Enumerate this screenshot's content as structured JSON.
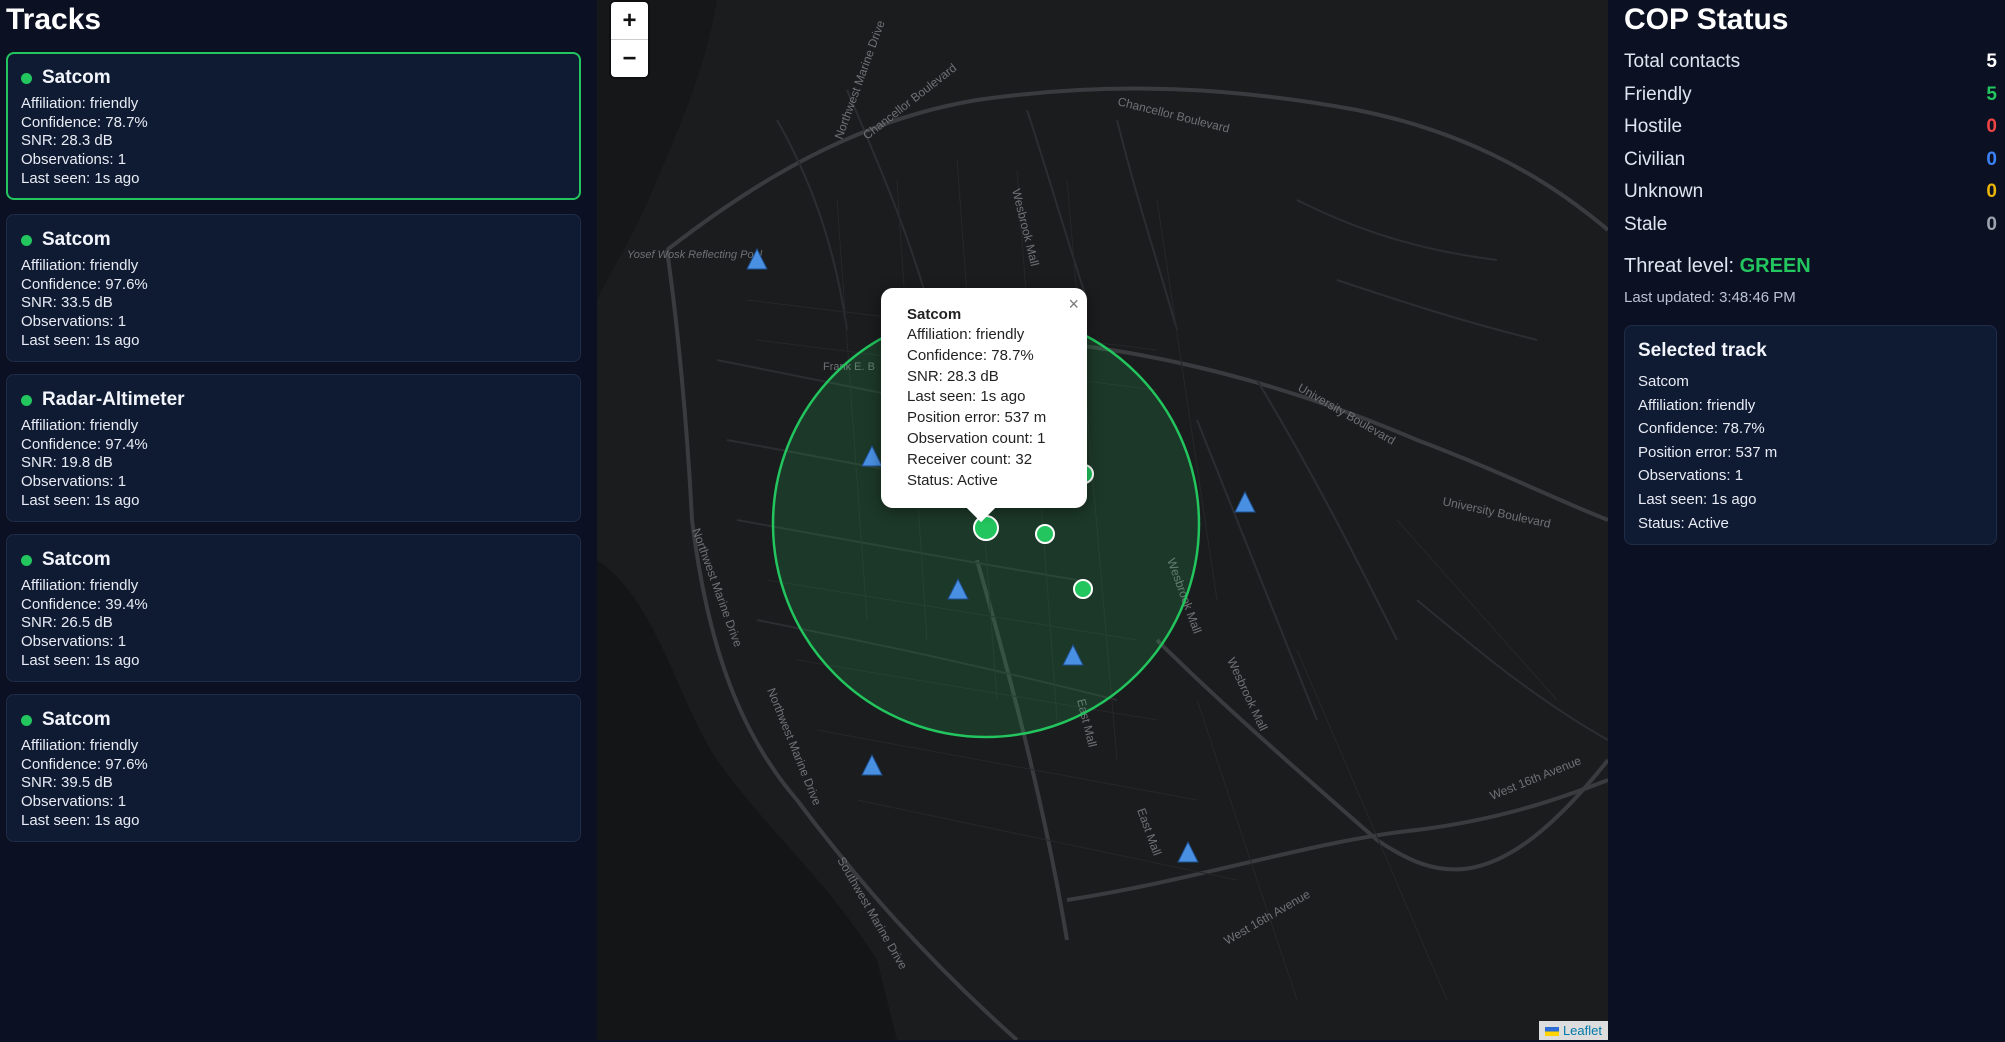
{
  "left_panel": {
    "title": "Tracks",
    "tracks": [
      {
        "name": "Satcom",
        "affiliation": "Affiliation: friendly",
        "confidence": "Confidence: 78.7%",
        "snr": "SNR: 28.3 dB",
        "observations": "Observations: 1",
        "last_seen": "Last seen: 1s ago",
        "status_color": "#22c55e"
      },
      {
        "name": "Satcom",
        "affiliation": "Affiliation: friendly",
        "confidence": "Confidence: 97.6%",
        "snr": "SNR: 33.5 dB",
        "observations": "Observations: 1",
        "last_seen": "Last seen: 1s ago",
        "status_color": "#22c55e"
      },
      {
        "name": "Radar-Altimeter",
        "affiliation": "Affiliation: friendly",
        "confidence": "Confidence: 97.4%",
        "snr": "SNR: 19.8 dB",
        "observations": "Observations: 1",
        "last_seen": "Last seen: 1s ago",
        "status_color": "#22c55e"
      },
      {
        "name": "Satcom",
        "affiliation": "Affiliation: friendly",
        "confidence": "Confidence: 39.4%",
        "snr": "SNR: 26.5 dB",
        "observations": "Observations: 1",
        "last_seen": "Last seen: 1s ago",
        "status_color": "#22c55e"
      },
      {
        "name": "Satcom",
        "affiliation": "Affiliation: friendly",
        "confidence": "Confidence: 97.6%",
        "snr": "SNR: 39.5 dB",
        "observations": "Observations: 1",
        "last_seen": "Last seen: 1s ago",
        "status_color": "#22c55e"
      }
    ]
  },
  "map": {
    "zoom_in_label": "+",
    "zoom_out_label": "−",
    "attribution": "Leaflet",
    "street_labels": [
      "Chancellor Boulevard",
      "Chancellor Boulevard",
      "University Boulevard",
      "University Boulevard",
      "Northwest Marine Drive",
      "Northwest Marine Drive",
      "Northwest Marine Drive",
      "Southwest Marine Drive",
      "Wesbrook Mall",
      "Wesbrook Mall",
      "Wesbrook Mall",
      "East Mall",
      "East Mall",
      "West 16th Avenue",
      "West 16th Avenue",
      "Yosef Wosk Reflecting Pool",
      "Frank E. B"
    ],
    "popup": {
      "title": "Satcom",
      "lines": [
        "Affiliation: friendly",
        "Confidence: 78.7%",
        "SNR: 28.3 dB",
        "Last seen: 1s ago",
        "Position error: 537 m",
        "Observation count: 1",
        "Receiver count: 32",
        "Status: Active"
      ],
      "close_glyph": "×"
    },
    "colors": {
      "friendly": "#22c55e",
      "receiver": "#4a90e2",
      "background": "#1a1b1d"
    }
  },
  "right_panel": {
    "title": "COP Status",
    "stats": [
      {
        "label": "Total contacts",
        "value": "5",
        "color": "#ffffff"
      },
      {
        "label": "Friendly",
        "value": "5",
        "color": "#22c55e"
      },
      {
        "label": "Hostile",
        "value": "0",
        "color": "#ef4444"
      },
      {
        "label": "Civilian",
        "value": "0",
        "color": "#3b82f6"
      },
      {
        "label": "Unknown",
        "value": "0",
        "color": "#eab308"
      },
      {
        "label": "Stale",
        "value": "0",
        "color": "#9ca3af"
      }
    ],
    "threat_label": "Threat level:",
    "threat_value": "GREEN",
    "threat_color": "#22c55e",
    "last_updated": "Last updated: 3:48:46 PM",
    "selected": {
      "heading": "Selected track",
      "lines": [
        "Satcom",
        "Affiliation: friendly",
        "Confidence: 78.7%",
        "Position error: 537 m",
        "Observations: 1",
        "Last seen: 1s ago",
        "Status: Active"
      ]
    }
  }
}
